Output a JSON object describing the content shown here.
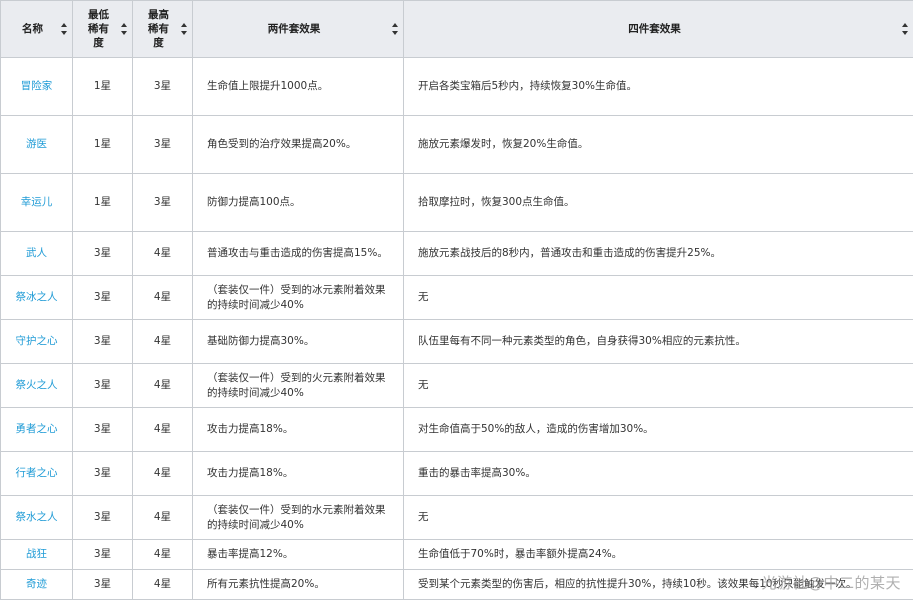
{
  "table": {
    "headers": {
      "name": "名称",
      "min_rarity": "最低稀有度",
      "max_rarity": "最高稀有度",
      "two_piece": "两件套效果",
      "four_piece": "四件套效果"
    },
    "rows": [
      {
        "name": "冒险家",
        "min": "1星",
        "max": "3星",
        "two": "生命值上限提升1000点。",
        "four": "开启各类宝箱后5秒内，持续恢复30%生命值。"
      },
      {
        "name": "游医",
        "min": "1星",
        "max": "3星",
        "two": "角色受到的治疗效果提高20%。",
        "four": "施放元素爆发时，恢复20%生命值。"
      },
      {
        "name": "幸运儿",
        "min": "1星",
        "max": "3星",
        "two": "防御力提高100点。",
        "four": "拾取摩拉时，恢复300点生命值。"
      },
      {
        "name": "武人",
        "min": "3星",
        "max": "4星",
        "two": "普通攻击与重击造成的伤害提高15%。",
        "four": "施放元素战技后的8秒内，普通攻击和重击造成的伤害提升25%。"
      },
      {
        "name": "祭冰之人",
        "min": "3星",
        "max": "4星",
        "two": "（套装仅一件）受到的冰元素附着效果的持续时间减少40%",
        "four": "无"
      },
      {
        "name": "守护之心",
        "min": "3星",
        "max": "4星",
        "two": "基础防御力提高30%。",
        "four": "队伍里每有不同一种元素类型的角色，自身获得30%相应的元素抗性。"
      },
      {
        "name": "祭火之人",
        "min": "3星",
        "max": "4星",
        "two": "（套装仅一件）受到的火元素附着效果的持续时间减少40%",
        "four": "无"
      },
      {
        "name": "勇者之心",
        "min": "3星",
        "max": "4星",
        "two": "攻击力提高18%。",
        "four": "对生命值高于50%的敌人，造成的伤害增加30%。"
      },
      {
        "name": "行者之心",
        "min": "3星",
        "max": "4星",
        "two": "攻击力提高18%。",
        "four": "重击的暴击率提高30%。"
      },
      {
        "name": "祭水之人",
        "min": "3星",
        "max": "4星",
        "two": "（套装仅一件）受到的水元素附着效果的持续时间减少40%",
        "four": "无"
      },
      {
        "name": "战狂",
        "min": "3星",
        "max": "4星",
        "two": "暴击率提高12%。",
        "four": "生命值低于70%时，暴击率额外提高24%。"
      },
      {
        "name": "奇迹",
        "min": "3星",
        "max": "4星",
        "two": "所有元素抗性提高20%。",
        "four": "受到某个元素类型的伤害后，相应的抗性提升30%，持续10秒。该效果每10秒只能触发一次。"
      }
    ]
  },
  "watermark": "光游社@中二的某天",
  "colors": {
    "link": "#1f9bd6",
    "header_bg": "#eaecf0",
    "border": "#c8ccd1"
  }
}
